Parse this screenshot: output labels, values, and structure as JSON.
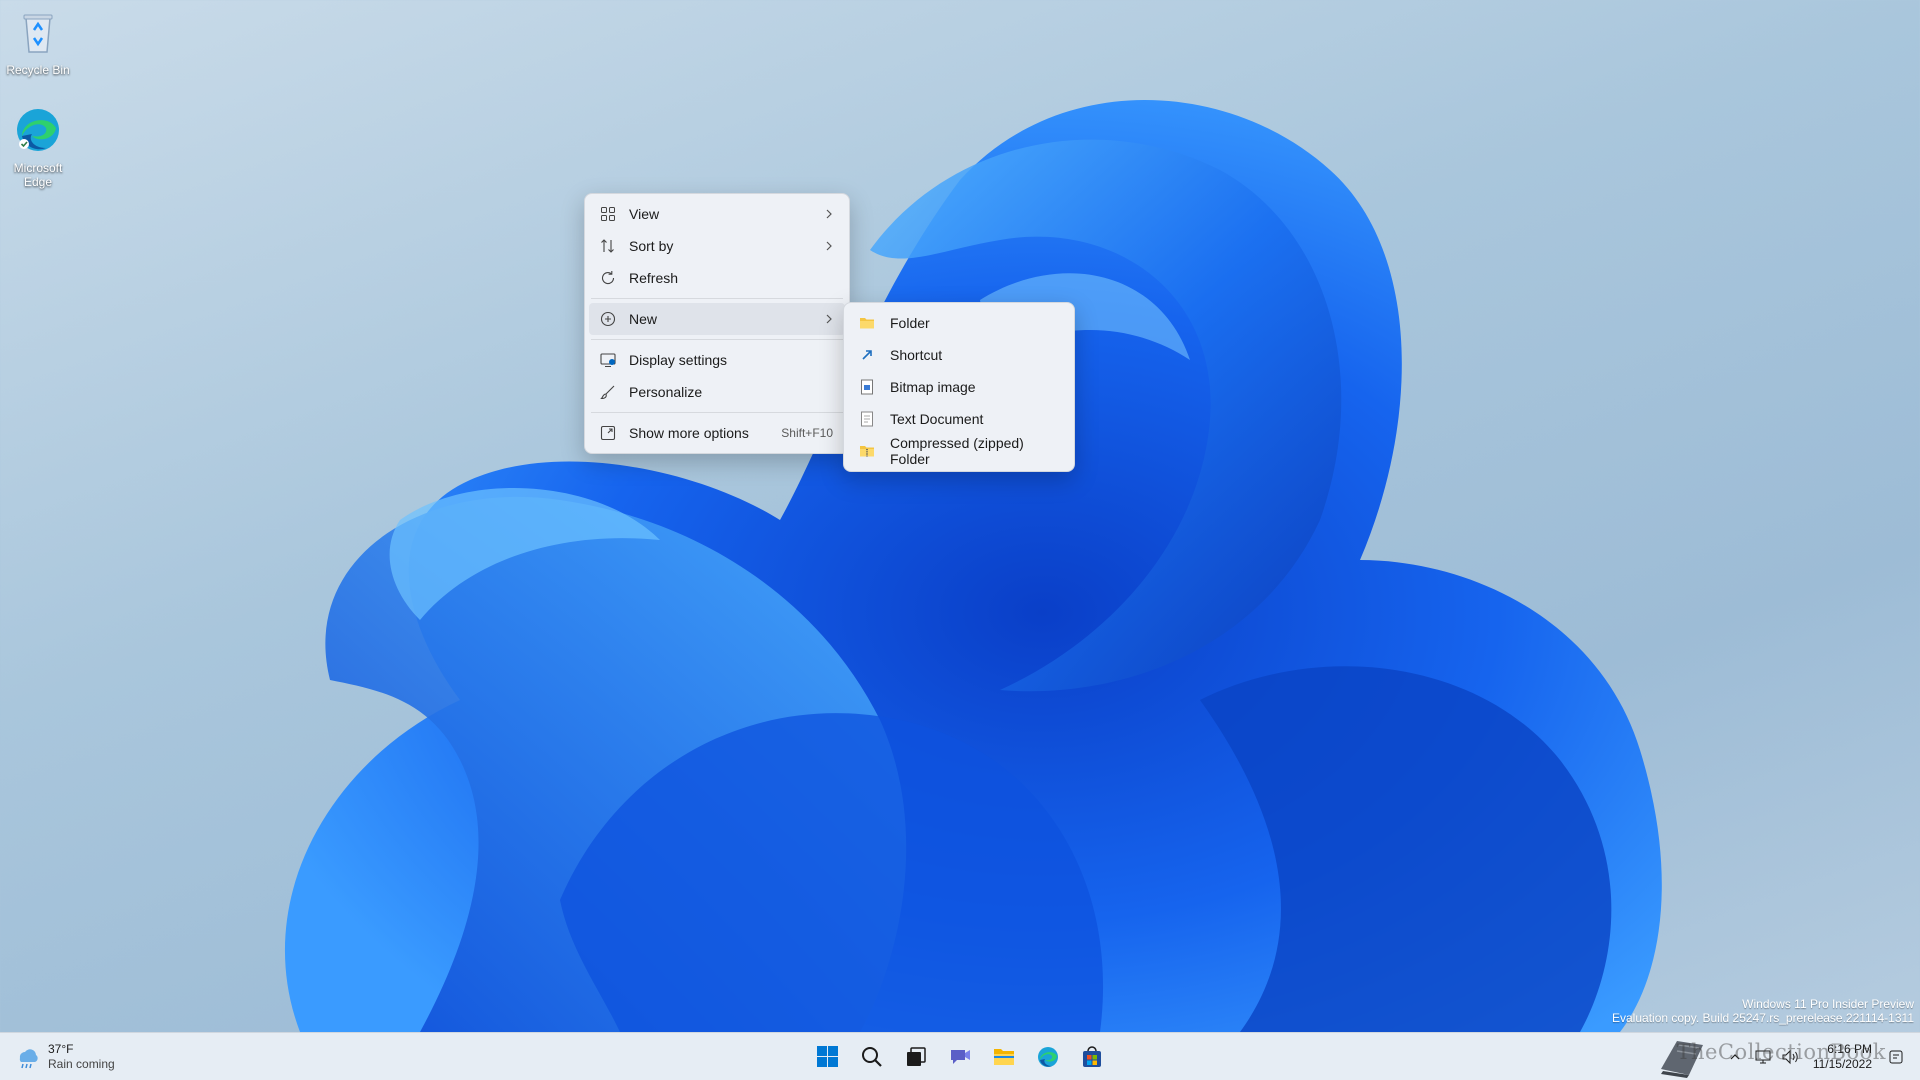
{
  "desktop": {
    "icons": [
      {
        "label": "Recycle Bin"
      },
      {
        "label": "Microsoft Edge"
      }
    ]
  },
  "context_menu": {
    "items": [
      {
        "label": "View",
        "icon": "grid-view-icon",
        "has_submenu": true
      },
      {
        "label": "Sort by",
        "icon": "sort-arrows-icon",
        "has_submenu": true
      },
      {
        "label": "Refresh",
        "icon": "refresh-icon",
        "has_submenu": false
      },
      {
        "label": "New",
        "icon": "plus-circle-icon",
        "has_submenu": true,
        "highlighted": true
      },
      {
        "label": "Display settings",
        "icon": "display-icon",
        "has_submenu": false
      },
      {
        "label": "Personalize",
        "icon": "brush-icon",
        "has_submenu": false
      },
      {
        "label": "Show more options",
        "icon": "expand-icon",
        "shortcut": "Shift+F10"
      }
    ]
  },
  "new_submenu": {
    "items": [
      {
        "label": "Folder",
        "icon": "folder-icon"
      },
      {
        "label": "Shortcut",
        "icon": "shortcut-arrow-icon"
      },
      {
        "label": "Bitmap image",
        "icon": "bitmap-file-icon"
      },
      {
        "label": "Text Document",
        "icon": "text-file-icon"
      },
      {
        "label": "Compressed (zipped) Folder",
        "icon": "zip-folder-icon"
      }
    ]
  },
  "watermark": {
    "line1": "Windows 11 Pro Insider Preview",
    "line2": "Evaluation copy. Build 25247.rs_prerelease.221114-1311"
  },
  "taskbar": {
    "weather": {
      "temp": "37°F",
      "condition": "Rain coming"
    },
    "apps": [
      "start-icon",
      "search-icon",
      "task-view-icon",
      "chat-icon",
      "file-explorer-icon",
      "edge-icon",
      "store-icon"
    ],
    "clock": {
      "time": "6:16 PM",
      "date": "11/15/2022"
    },
    "site_watermark": "TheCollectionBook"
  },
  "colors": {
    "accent": "#0067c0",
    "menu_bg": "#eef1f6",
    "taskbar_bg": "#e6edf4"
  }
}
